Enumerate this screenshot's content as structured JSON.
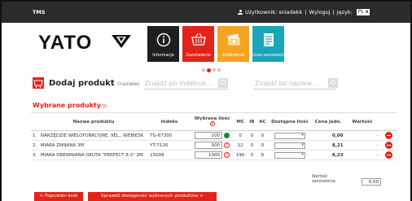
{
  "topbar": {
    "app_name": "TMS",
    "user_prefix": "Użytkownik: sniadekk",
    "separator1": "|",
    "logout_label": "Wyloguj",
    "separator2": "|",
    "language_label": "Język:",
    "language_value": "PL"
  },
  "header": {
    "logo_text": "YATO",
    "nav": [
      {
        "label": "Informacje",
        "icon": "info-icon",
        "color": "#1e1e1e"
      },
      {
        "label": "Zamówienie",
        "icon": "basket-icon",
        "color": "#e2231a"
      },
      {
        "label": "Zadłużenie",
        "icon": "money-icon",
        "color": "#f2a422"
      },
      {
        "label": "Lista zamówień",
        "icon": "document-list-icon",
        "color": "#1aa5b8"
      }
    ],
    "step_dots": 4,
    "active_step": 2
  },
  "add_product": {
    "title": "Dodaj produkt",
    "subtitle": "(nazwie)",
    "search_index_placeholder": "Znajdź po indeksie...",
    "search_name_placeholder": "Znajdź po nazwie..."
  },
  "selected": {
    "title": "Wybrane produkty",
    "count": "(3)"
  },
  "table": {
    "headers": {
      "name": "Nazwa produktu",
      "index": "Indeks",
      "qty": "Wybrana ilość",
      "mc": "MC",
      "ib": "IB",
      "ac": "AC",
      "avail": "Dostępna ilość",
      "price": "Cena jedn.",
      "value": "Wartość"
    },
    "rows": [
      {
        "no": "1.",
        "name": "NARZĘDZIE WIELOFUNKCYJNE, 9EL., NIEBIESK",
        "index": "TG-67300",
        "qty": "100",
        "qty_status": "ok",
        "mc": "0",
        "ib": "0",
        "ac": "0",
        "price": "0,00",
        "value": "-"
      },
      {
        "no": "2.",
        "name": "MIARA ZWIJANA 3M",
        "index": "YT-7126",
        "qty": "500",
        "qty_status": "warn",
        "mc": "12",
        "ib": "0",
        "ac": "0",
        "price": "8,21",
        "value": "-"
      },
      {
        "no": "3.",
        "name": "MIARA DREWNIANA OKUTA \"PERFECT 8-2\" 2M",
        "index": "15006",
        "qty": "1000",
        "qty_status": "warn",
        "mc": "190",
        "ib": "0",
        "ac": "0",
        "price": "8,23",
        "value": "-"
      }
    ],
    "total_label_line1": "Wartość",
    "total_label_line2": "zamówienia:",
    "total_value": "0,00"
  },
  "footer": {
    "prev_label": "<  Poprzedni krok",
    "check_label": "Sprawdź dostępność wybranych produktów  >"
  },
  "colors": {
    "accent": "#e2231a",
    "topbar": "#2b2b2b",
    "ok": "#1a8a2a"
  }
}
